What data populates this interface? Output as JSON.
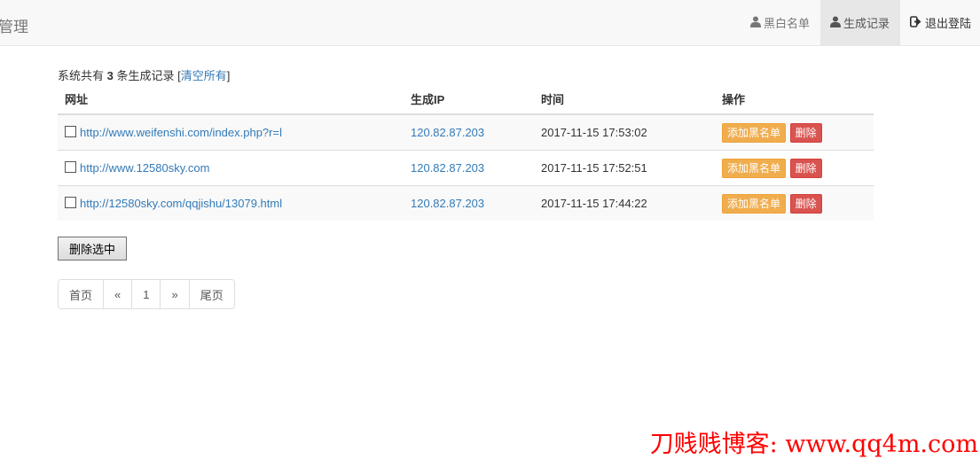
{
  "header": {
    "brand": "管理",
    "nav": [
      {
        "label": "黑白名单",
        "icon": "user-icon"
      },
      {
        "label": "生成记录",
        "icon": "user-icon",
        "active": true
      },
      {
        "label": "退出登陆",
        "icon": "logout-icon"
      }
    ]
  },
  "summary": {
    "prefix": "系统共有",
    "count": "3",
    "suffix": "条生成记录",
    "bracket_open": "[",
    "clear_label": "清空所有",
    "bracket_close": "]"
  },
  "table": {
    "headers": [
      "网址",
      "生成IP",
      "时间",
      "操作"
    ],
    "rows": [
      {
        "url": "http://www.weifenshi.com/index.php?r=l",
        "ip": "120.82.87.203",
        "time": "2017-11-15 17:53:02"
      },
      {
        "url": "http://www.12580sky.com",
        "ip": "120.82.87.203",
        "time": "2017-11-15 17:52:51"
      },
      {
        "url": "http://12580sky.com/qqjishu/13079.html",
        "ip": "120.82.87.203",
        "time": "2017-11-15 17:44:22"
      }
    ],
    "add_blacklist_label": "添加黑名单",
    "delete_label": "删除"
  },
  "delete_selected_label": "删除选中",
  "pagination": [
    "首页",
    "«",
    "1",
    "»",
    "尾页"
  ],
  "watermark": "刀贱贱博客: www.qq4m.com",
  "colors": {
    "link": "#337ab7",
    "warning": "#f0ad4e",
    "danger": "#d9534f",
    "watermark": "#ff0000"
  }
}
